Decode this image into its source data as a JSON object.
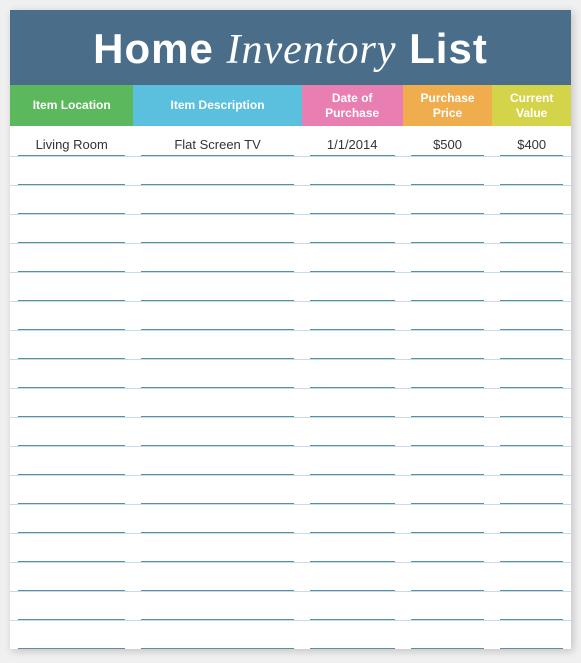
{
  "header": {
    "title_part1": "Home ",
    "title_part2": "Inventory",
    "title_part3": " List"
  },
  "columns": {
    "location": "Item Location",
    "description": "Item Description",
    "date": "Date of Purchase",
    "purchase_price": "Purchase Price",
    "current_value": "Current Value"
  },
  "rows": [
    {
      "location": "Living Room",
      "description": "Flat Screen TV",
      "date": "1/1/2014",
      "purchase_price": "$500",
      "current_value": "$400"
    },
    {
      "location": "",
      "description": "",
      "date": "",
      "purchase_price": "",
      "current_value": ""
    },
    {
      "location": "",
      "description": "",
      "date": "",
      "purchase_price": "",
      "current_value": ""
    },
    {
      "location": "",
      "description": "",
      "date": "",
      "purchase_price": "",
      "current_value": ""
    },
    {
      "location": "",
      "description": "",
      "date": "",
      "purchase_price": "",
      "current_value": ""
    },
    {
      "location": "",
      "description": "",
      "date": "",
      "purchase_price": "",
      "current_value": ""
    },
    {
      "location": "",
      "description": "",
      "date": "",
      "purchase_price": "",
      "current_value": ""
    },
    {
      "location": "",
      "description": "",
      "date": "",
      "purchase_price": "",
      "current_value": ""
    },
    {
      "location": "",
      "description": "",
      "date": "",
      "purchase_price": "",
      "current_value": ""
    },
    {
      "location": "",
      "description": "",
      "date": "",
      "purchase_price": "",
      "current_value": ""
    },
    {
      "location": "",
      "description": "",
      "date": "",
      "purchase_price": "",
      "current_value": ""
    },
    {
      "location": "",
      "description": "",
      "date": "",
      "purchase_price": "",
      "current_value": ""
    },
    {
      "location": "",
      "description": "",
      "date": "",
      "purchase_price": "",
      "current_value": ""
    },
    {
      "location": "",
      "description": "",
      "date": "",
      "purchase_price": "",
      "current_value": ""
    },
    {
      "location": "",
      "description": "",
      "date": "",
      "purchase_price": "",
      "current_value": ""
    },
    {
      "location": "",
      "description": "",
      "date": "",
      "purchase_price": "",
      "current_value": ""
    },
    {
      "location": "",
      "description": "",
      "date": "",
      "purchase_price": "",
      "current_value": ""
    },
    {
      "location": "",
      "description": "",
      "date": "",
      "purchase_price": "",
      "current_value": ""
    }
  ]
}
